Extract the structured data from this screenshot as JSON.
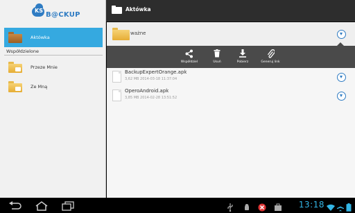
{
  "app": {
    "logo_ks": "KS",
    "logo_backup": "B@CKUP"
  },
  "sidebar": {
    "active_item": {
      "label": "Aktówka",
      "icon": "briefcase-folder-icon"
    },
    "shared_header": "Współdzielone",
    "shared_items": [
      {
        "label": "Przeze Mnie",
        "icon": "shared-folder-icon"
      },
      {
        "label": "Ze Mną",
        "icon": "shared-folder-icon"
      }
    ]
  },
  "header": {
    "title": "Aktówka",
    "icon": "folder-icon"
  },
  "folder": {
    "name": "ważne"
  },
  "actions": [
    {
      "label": "Współdziel",
      "icon": "share-icon"
    },
    {
      "label": "Usuń",
      "icon": "trash-icon"
    },
    {
      "label": "Pobierz",
      "icon": "download-icon"
    },
    {
      "label": "Generuj link",
      "icon": "link-icon"
    }
  ],
  "files": [
    {
      "name": "BackupExpertOrange.apk",
      "meta": "3,62 MB  2014-03-18 11:37:04"
    },
    {
      "name": "OperoAndroid.apk",
      "meta": "3,85 MB  2014-02-28 13:51:52"
    }
  ],
  "statusbar": {
    "clock": "13:18"
  },
  "colors": {
    "accent": "#35a9e0",
    "logo": "#2f7cc3",
    "clock": "#33b5e5",
    "action_bar": "#4a4a4a",
    "top_bar": "#2d2d2d"
  }
}
